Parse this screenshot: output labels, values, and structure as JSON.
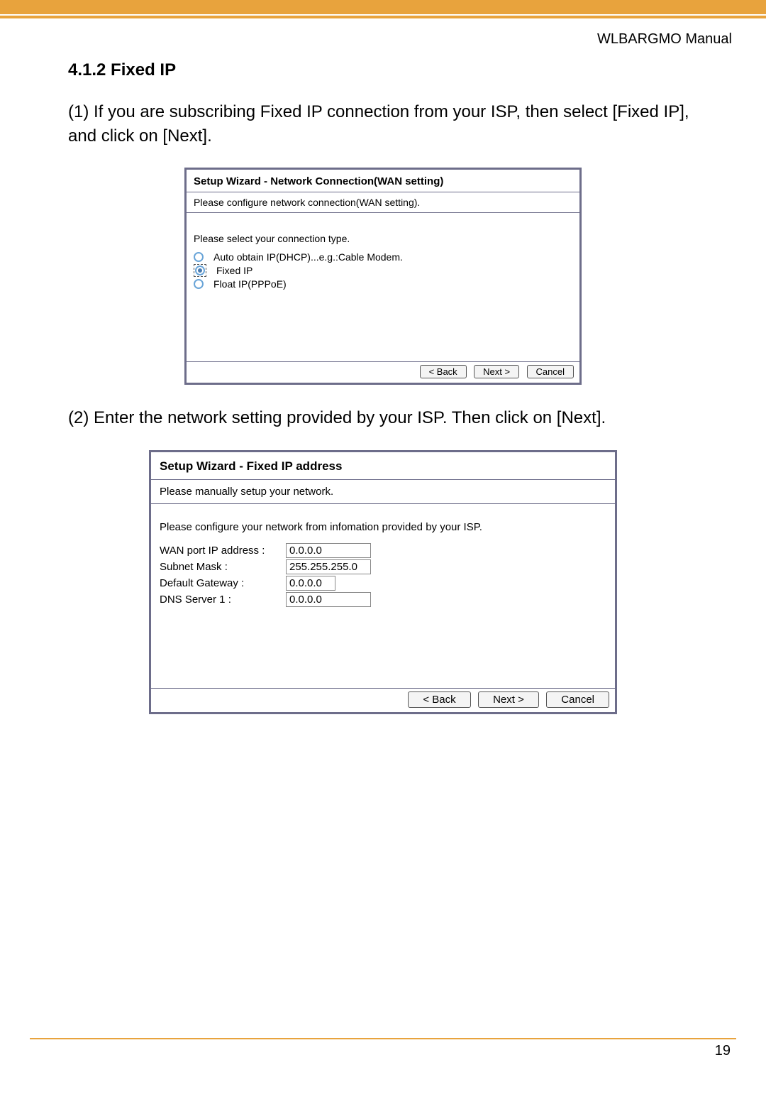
{
  "header": {
    "manual": "WLBARGMO Manual"
  },
  "section": {
    "number_title": "4.1.2 Fixed IP"
  },
  "step1": {
    "text": "(1) If you are subscribing Fixed IP connection from your ISP, then select [Fixed IP], and click on [Next]."
  },
  "dialog1": {
    "title": "Setup Wizard - Network Connection(WAN setting)",
    "desc": "Please configure network connection(WAN setting).",
    "prompt": "Please select your connection type.",
    "options": {
      "dhcp": "Auto obtain IP(DHCP)...e.g.:Cable Modem.",
      "fixed": "Fixed IP",
      "pppoe": "Float IP(PPPoE)"
    },
    "buttons": {
      "back": "< Back",
      "next": "Next >",
      "cancel": "Cancel"
    }
  },
  "step2": {
    "text": "(2) Enter the network setting provided by your ISP. Then click on [Next]."
  },
  "dialog2": {
    "title": "Setup Wizard - Fixed IP address",
    "desc": "Please manually setup your network.",
    "prompt": "Please configure your network from infomation provided by your ISP.",
    "fields": {
      "wan_label": "WAN port IP address :",
      "wan_value": "0.0.0.0",
      "subnet_label": "Subnet Mask :",
      "subnet_value": "255.255.255.0",
      "gateway_label": "Default Gateway :",
      "gateway_value": "0.0.0.0",
      "dns_label": "DNS Server 1 :",
      "dns_value": "0.0.0.0"
    },
    "buttons": {
      "back": "< Back",
      "next": "Next >",
      "cancel": "Cancel"
    }
  },
  "page_number": "19"
}
